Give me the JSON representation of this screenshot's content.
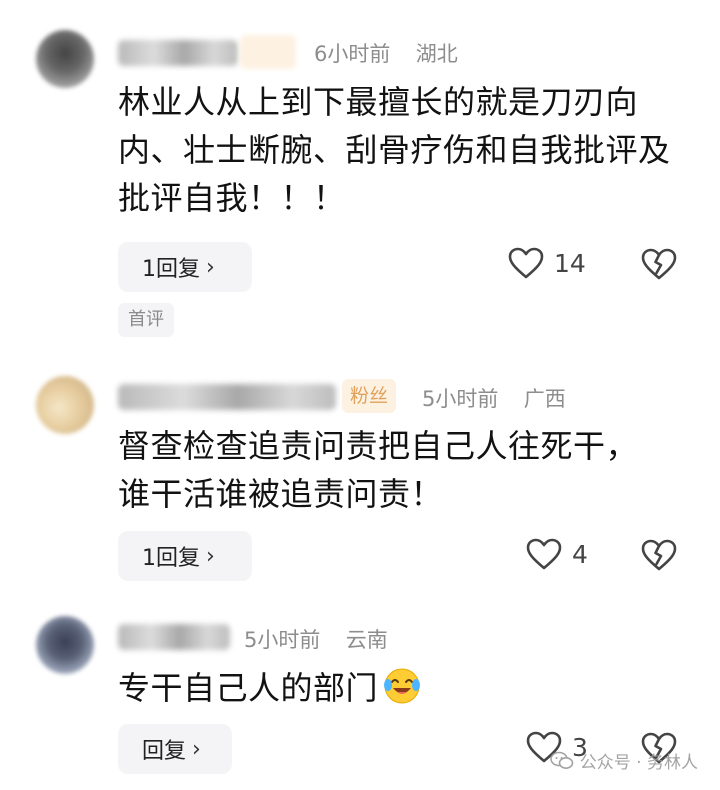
{
  "comments": [
    {
      "time": "6小时前",
      "region": "湖北",
      "text": "林业人从上到下最擅长的就是刀刃向内、壮士断腕、刮骨疗伤和自我批评及批评自我！！！",
      "reply_label": "1回复",
      "likes": "14",
      "tag": "首评",
      "avatar_icon": "blurred-avatar-icon"
    },
    {
      "time": "5小时前",
      "region": "广西",
      "badge": "粉丝",
      "text": "督查检查追责问责把自己人往死干，谁干活谁被追责问责！",
      "reply_label": "1回复",
      "likes": "4",
      "avatar_icon": "blurred-avatar-icon"
    },
    {
      "time": "5小时前",
      "region": "云南",
      "text": "专干自己人的部门",
      "reply_label": "回复",
      "likes": "3",
      "emoji_icon": "laughing-crying-emoji-icon",
      "avatar_icon": "blurred-avatar-icon"
    }
  ],
  "watermark": {
    "text": "公众号 · 务林人",
    "icon": "wechat-icon"
  },
  "colors": {
    "badge_text": "#e0a25a",
    "badge_bg": "#fdf1e2",
    "meta": "#8d8d8d",
    "button_bg": "#f4f4f6"
  }
}
